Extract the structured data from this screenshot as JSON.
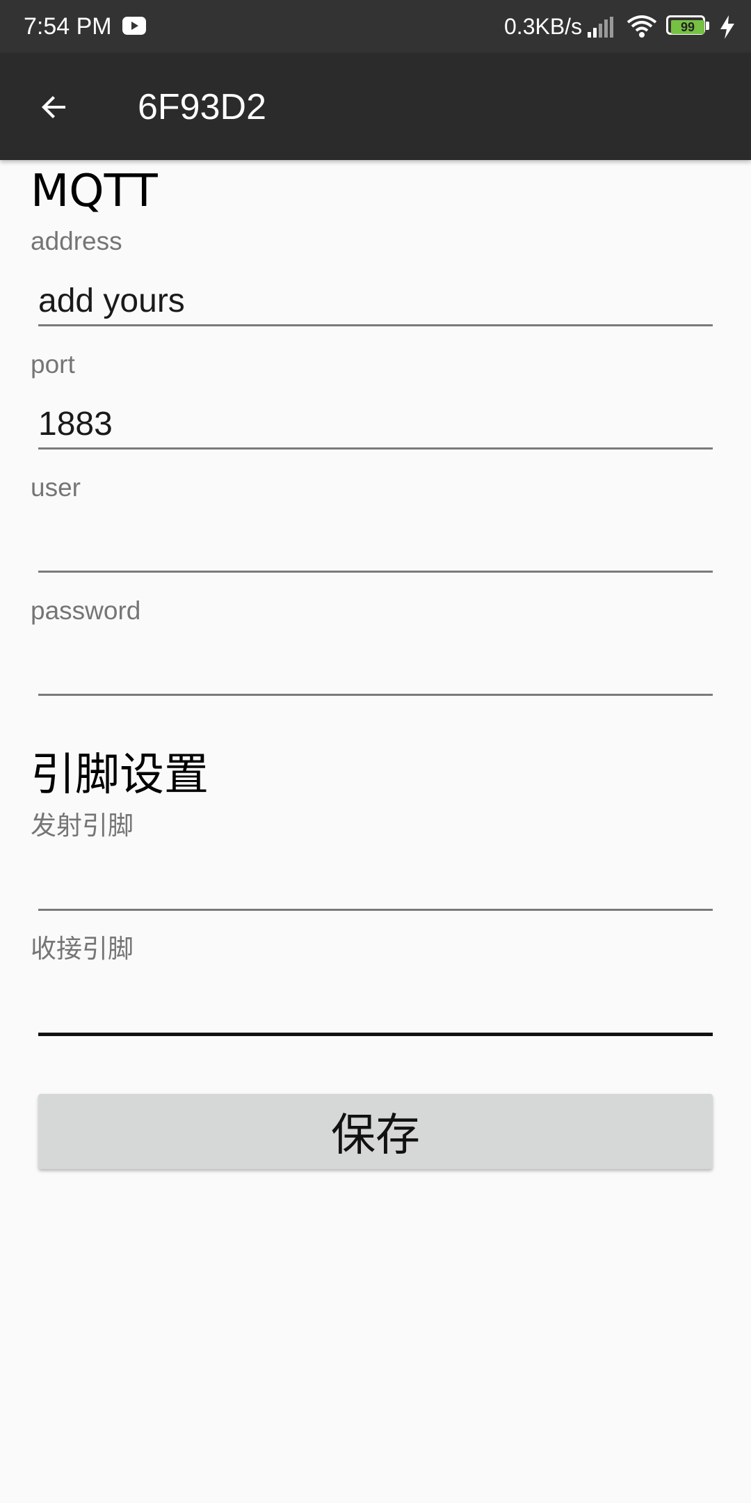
{
  "status_bar": {
    "time": "7:54 PM",
    "net_speed": "0.3KB/s",
    "battery_level": "99",
    "icons": [
      "youtube-icon",
      "signal-icon",
      "wifi-icon",
      "battery-icon",
      "charging-bolt-icon"
    ]
  },
  "app_bar": {
    "title": "6F93D2",
    "back_icon": "arrow-back-icon"
  },
  "mqtt": {
    "section_title": "MQTT",
    "address_label": "address",
    "address_value": "add yours",
    "port_label": "port",
    "port_value": "1883",
    "user_label": "user",
    "user_value": "",
    "password_label": "password",
    "password_value": ""
  },
  "pins": {
    "section_title": "引脚设置",
    "tx_label": "发射引脚",
    "tx_value": "",
    "rx_label": "收接引脚",
    "rx_value": ""
  },
  "save_label": "保存",
  "colors": {
    "status_bar_bg": "#333333",
    "app_bar_bg": "#2b2b2b",
    "page_bg": "#fafafa",
    "button_bg": "#d6d7d7",
    "battery_green": "#76c043"
  }
}
